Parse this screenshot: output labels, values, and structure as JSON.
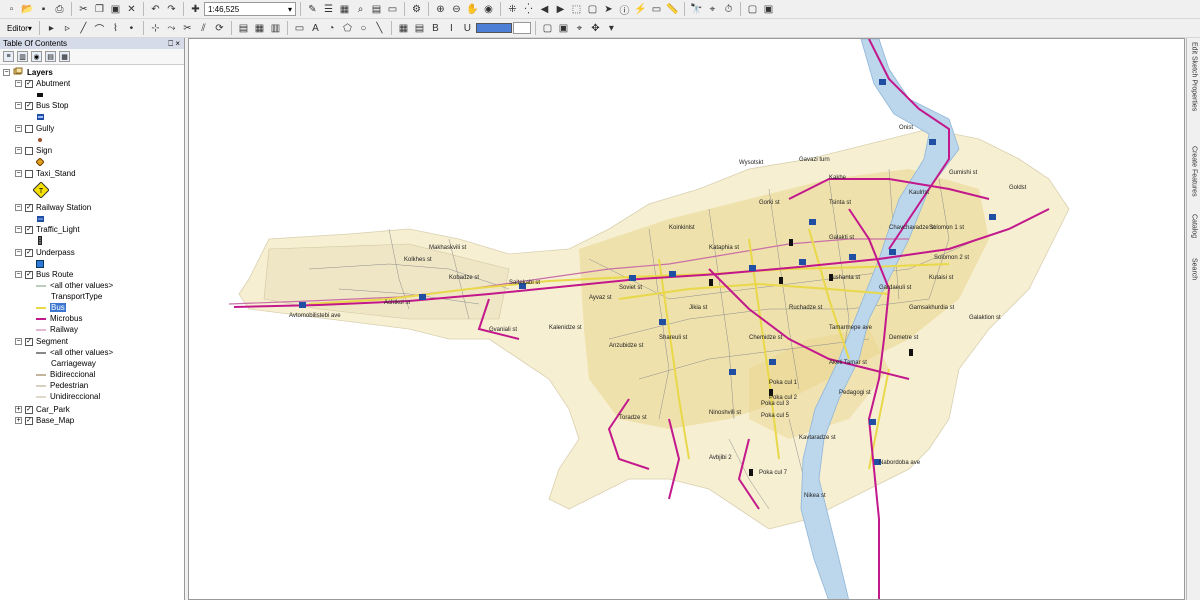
{
  "toolbar": {
    "scale_value": "1:46,525",
    "editor_label": "Editor▾"
  },
  "toc": {
    "title": "Table Of Contents",
    "pin": "⎕",
    "close": "×",
    "layers_label": "Layers",
    "layers": [
      {
        "label": "Abutment",
        "checked": true
      },
      {
        "label": "Bus Stop",
        "checked": true
      },
      {
        "label": "Gully",
        "checked": false
      },
      {
        "label": "Sign",
        "checked": false
      },
      {
        "label": "Taxi_Stand",
        "checked": false
      },
      {
        "label": "Railway Station",
        "checked": true
      },
      {
        "label": "Traffic_Light",
        "checked": true
      },
      {
        "label": "Underpass",
        "checked": true
      },
      {
        "label": "Bus Route",
        "checked": true
      },
      {
        "label": "Segment",
        "checked": true
      },
      {
        "label": "Car_Park",
        "checked": true
      },
      {
        "label": "Base_Map",
        "checked": true
      }
    ],
    "bus_route_legend": {
      "all_other": "<all other values>",
      "field": "TransportType",
      "classes": [
        "Bus",
        "Microbus",
        "Railway"
      ]
    },
    "segment_legend": {
      "all_other": "<all other values>",
      "field": "Carriageway",
      "classes": [
        "Bidireccional",
        "Pedestrian",
        "Unidireccional"
      ]
    }
  },
  "map": {
    "street_labels": [
      "Onist",
      "Wysotskt",
      "Gavazi turn",
      "Kakhe",
      "Gorki st",
      "Tsinta st",
      "Kaulrlst",
      "Koinkinlst",
      "Solomon 1 st",
      "Solomon 2 st",
      "Goldst",
      "Gumishi st",
      "Galakti st",
      "Chavchavadze st",
      "Kutaisi st",
      "Gardaeuli st",
      "Kolkhes st",
      "Makhaskvili st",
      "Achtkol st",
      "Saitekabi st",
      "Avtomobilistebi ave",
      "Ayvaz st",
      "Gvaniali st",
      "Kobadze st",
      "Anzubidze st",
      "Tamarmepe ave",
      "Lushanta st",
      "Ninoshvili st",
      "Kalenidze st",
      "Shareuli st",
      "Soviet st",
      "Poka cul 1",
      "Poka cul 2",
      "Poka cul 3",
      "Poka cul 5",
      "Poka cul 7",
      "Avbjibi 2",
      "Aketi Tamar st",
      "Chemidze st",
      "Ruchadze st",
      "Jikia st",
      "Toradze st",
      "Kavtaradze st",
      "Galaktion st",
      "Kataphia st",
      "Nabordoba ave",
      "Pedagogi st",
      "Demetre st",
      "Gamsakhurdia st",
      "Nikea st"
    ]
  },
  "right_tabs": [
    "Edit Sketch Properties",
    "Create Features",
    "Catalog",
    "Search"
  ],
  "colors": {
    "bus": "#e8d84a",
    "microbus": "#c2188c",
    "railway": "#c96fa8",
    "river": "#bcd6ec",
    "basemap": "#f7efd2",
    "blocks": "#e9d58a",
    "roads": "#8d8d8d",
    "bus_stop": "#1f4ea3"
  }
}
